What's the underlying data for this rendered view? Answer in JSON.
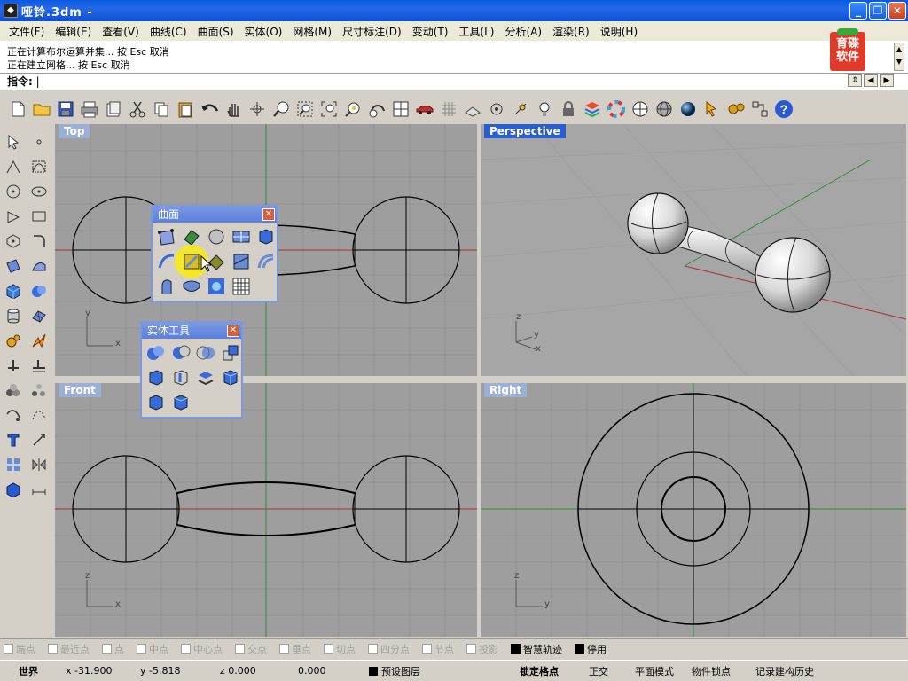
{
  "app": {
    "title": "哑铃.3dm -",
    "icon": "rhino-app-icon"
  },
  "window_buttons": [
    "minimize-icon",
    "restore-icon",
    "close-icon"
  ],
  "menu": [
    "文件(F)",
    "编辑(E)",
    "查看(V)",
    "曲线(C)",
    "曲面(S)",
    "实体(O)",
    "网格(M)",
    "尺寸标注(D)",
    "变动(T)",
    "工具(L)",
    "分析(A)",
    "渲染(R)",
    "说明(H)"
  ],
  "command_history": [
    "正在计算布尔运算并集... 按 Esc 取消",
    "正在建立网格... 按 Esc 取消"
  ],
  "prompt": {
    "label": "指令:",
    "value": "|"
  },
  "logo": {
    "line1": "育碟",
    "line2": "软件"
  },
  "toolbar_icons": [
    "new-file-icon",
    "open-folder-icon",
    "save-icon",
    "print-icon",
    "properties-icon",
    "cut-icon",
    "copy-icon",
    "paste-icon",
    "undo-icon",
    "pan-hand-icon",
    "rotate-view-icon",
    "zoom-icon",
    "zoom-window-icon",
    "zoom-extents-icon",
    "zoom-selected-icon",
    "undo-view-icon",
    "four-viewports-icon",
    "car-icon",
    "grid-icon",
    "cplane-icon",
    "snap-icon",
    "point-icon",
    "light-icon",
    "lock-icon",
    "layer-icon",
    "color-wheel-icon",
    "wireframe-icon",
    "shaded-icon",
    "render-sphere-icon",
    "select-icon",
    "settings-icon",
    "options-icon",
    "help-icon"
  ],
  "viewports": {
    "top": "Top",
    "perspective": "Perspective",
    "front": "Front",
    "right": "Right"
  },
  "axis_labels": {
    "x": "x",
    "y": "y",
    "z": "z"
  },
  "surface_panel": {
    "title": "曲面",
    "tools": [
      "surface-from-points-icon",
      "plane-surface-icon",
      "sphere-surface-icon",
      "rectangle-surface-icon",
      "extrude-surface-icon",
      "loft-icon",
      "sweep-icon",
      "network-surface-icon",
      "revolve-icon",
      "sweep-2-rails-icon",
      "blend-surface-icon",
      "patch-icon",
      "heightfield-icon"
    ]
  },
  "solid_panel": {
    "title": "实体工具",
    "tools": [
      "boolean-union-icon",
      "boolean-difference-icon",
      "boolean-intersection-icon",
      "boolean-split-icon",
      "extract-surface-icon",
      "cap-planar-holes-icon",
      "split-solid-icon",
      "merge-faces-icon",
      "box-solid-icon",
      "cylinder-solid-icon"
    ]
  },
  "osnap": [
    {
      "label": "端点",
      "on": false
    },
    {
      "label": "最近点",
      "on": false
    },
    {
      "label": "点",
      "on": false
    },
    {
      "label": "中点",
      "on": false
    },
    {
      "label": "中心点",
      "on": false
    },
    {
      "label": "交点",
      "on": false
    },
    {
      "label": "垂点",
      "on": false
    },
    {
      "label": "切点",
      "on": false
    },
    {
      "label": "四分点",
      "on": false
    },
    {
      "label": "节点",
      "on": false
    },
    {
      "label": "投影",
      "on": false
    },
    {
      "label": "智慧轨迹",
      "on": true
    },
    {
      "label": "停用",
      "on": true
    }
  ],
  "statusbar": {
    "coord_system": "世界",
    "x": "x -31.900",
    "y": "y -5.818",
    "z": "z 0.000",
    "d": "0.000",
    "layer": "预设图层",
    "grid_snap": "锁定格点",
    "ortho": "正交",
    "planar": "平面模式",
    "osnap": "物件锁点",
    "history": "记录建构历史"
  },
  "colors": {
    "titlebar": "#0a5ae0",
    "viewport_bg": "#9e9e9e",
    "active_viewport_tab": "#2a5cd2",
    "x_axis": "#b03030",
    "y_axis": "#2f8f2f"
  }
}
